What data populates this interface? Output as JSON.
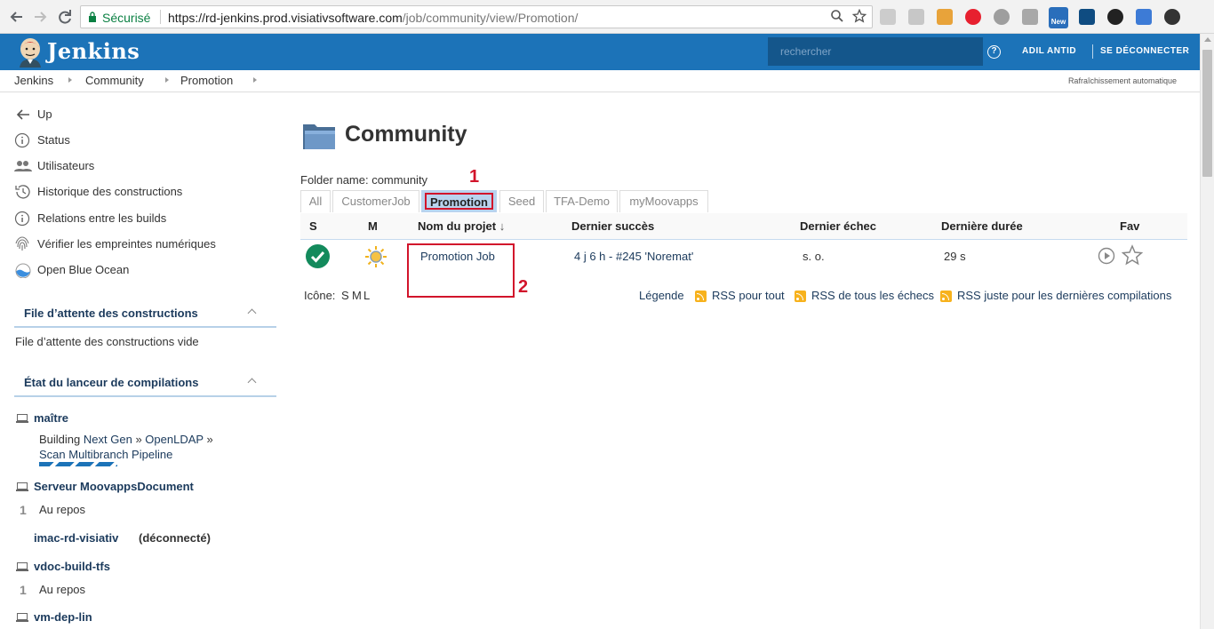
{
  "browser": {
    "secure_label": "Sécurisé",
    "url_host": "https://rd-jenkins.prod.visiativsoftware.com",
    "url_path": "/job/community/view/Promotion/",
    "ext_new_badge": "New"
  },
  "header": {
    "brand": "Jenkins",
    "search_placeholder": "rechercher",
    "help_glyph": "?",
    "user": "ADIL ANTID",
    "logout": "SE DÉCONNECTER"
  },
  "breadcrumb": {
    "items": [
      "Jenkins",
      "Community",
      "Promotion"
    ],
    "auto_refresh": "Rafraîchissement automatique"
  },
  "sidebar": {
    "tasks": [
      {
        "label": "Up",
        "icon": "arrow-left-icon"
      },
      {
        "label": "Status",
        "icon": "info-icon"
      },
      {
        "label": "Utilisateurs",
        "icon": "users-icon"
      },
      {
        "label": "Historique des constructions",
        "icon": "history-icon"
      },
      {
        "label": "Relations entre les builds",
        "icon": "info-icon"
      },
      {
        "label": "Vérifier les empreintes numériques",
        "icon": "fingerprint-icon"
      },
      {
        "label": "Open Blue Ocean",
        "icon": "blue-ocean-icon"
      }
    ],
    "queue": {
      "title": "File d’attente des constructions",
      "empty": "File d’attente des constructions vide"
    },
    "executors": {
      "title": "État du lanceur de compilations",
      "nodes": [
        {
          "name": "maître",
          "building_prefix": "Building",
          "build_link_1": "Next Gen",
          "sep": "»",
          "build_link_2": "OpenLDAP",
          "build_link_3": "Scan Multibranch Pipeline"
        },
        {
          "name": "Serveur MoovappsDocument",
          "executor_num": "1",
          "executor_status": "Au repos"
        },
        {
          "name": "imac-rd-visiativ",
          "status": "(déconnecté)"
        },
        {
          "name": "vdoc-build-tfs",
          "executor_num": "1",
          "executor_status": "Au repos"
        },
        {
          "name": "vm-dep-lin"
        }
      ]
    }
  },
  "main": {
    "title": "Community",
    "folder_name": "Folder name: community",
    "tabs": [
      "All",
      "CustomerJob",
      "Promotion",
      "Seed",
      "TFA-Demo",
      "myMoovapps"
    ],
    "active_tab": "Promotion",
    "annotations": [
      "1",
      "2"
    ],
    "columns": {
      "s": "S",
      "m": "M",
      "name": "Nom du projet",
      "sort_arrow": "↓",
      "last_success": "Dernier succès",
      "last_failure": "Dernier échec",
      "last_duration": "Dernière durée",
      "fav": "Fav"
    },
    "rows": [
      {
        "name": "Promotion Job",
        "last_success": "4 j 6 h - #245 'Noremat'",
        "last_failure": "s. o.",
        "last_duration": "29 s",
        "status_color": "#138a5c",
        "weather_icon": "sunny-icon"
      }
    ],
    "icon_size": {
      "label": "Icône:",
      "sizes": [
        "S",
        "M",
        "L"
      ]
    },
    "footer_links": {
      "legend": "Légende",
      "rss_all": "RSS pour tout",
      "rss_failures": "RSS de tous les échecs",
      "rss_latest": "RSS juste pour les dernières compilations"
    }
  },
  "colors": {
    "header_bg": "#1c73b8",
    "search_bg": "#14568b",
    "active_tab": "#b9d3ee",
    "annotation": "#d2142b",
    "success": "#138a5c"
  }
}
